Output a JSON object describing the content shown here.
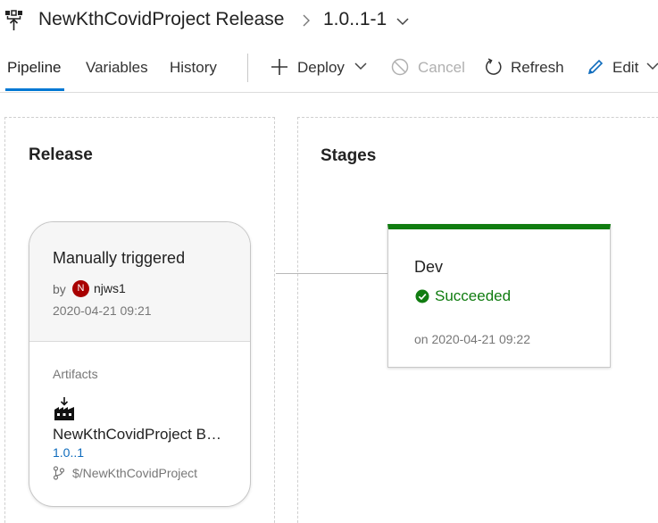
{
  "header": {
    "title": "NewKthCovidProject Release",
    "version": "1.0..1-1"
  },
  "tabs": [
    {
      "label": "Pipeline",
      "active": true
    },
    {
      "label": "Variables",
      "active": false
    },
    {
      "label": "History",
      "active": false
    }
  ],
  "commands": {
    "deploy": "Deploy",
    "cancel": "Cancel",
    "refresh": "Refresh",
    "edit": "Edit"
  },
  "release_panel": {
    "title": "Release",
    "card": {
      "trigger": "Manually triggered",
      "by_label": "by",
      "avatar_initial": "N",
      "user": "njws1",
      "date": "2020-04-21 09:21",
      "artifacts_label": "Artifacts",
      "artifact_name": "NewKthCovidProject Build",
      "artifact_version": "1.0..1",
      "artifact_source": "$/NewKthCovidProject"
    }
  },
  "stages_panel": {
    "title": "Stages",
    "stage": {
      "name": "Dev",
      "status": "Succeeded",
      "date": "on 2020-04-21 09:22"
    }
  },
  "colors": {
    "accent": "#0078d4",
    "success": "#107c10",
    "avatar": "#a80000"
  },
  "icons": [
    "pipeline-icon",
    "chevron-right-icon",
    "chevron-down-icon",
    "plus-icon",
    "cancel-icon",
    "refresh-icon",
    "pencil-icon",
    "build-artifact-icon",
    "branch-icon",
    "check-circle-icon"
  ]
}
